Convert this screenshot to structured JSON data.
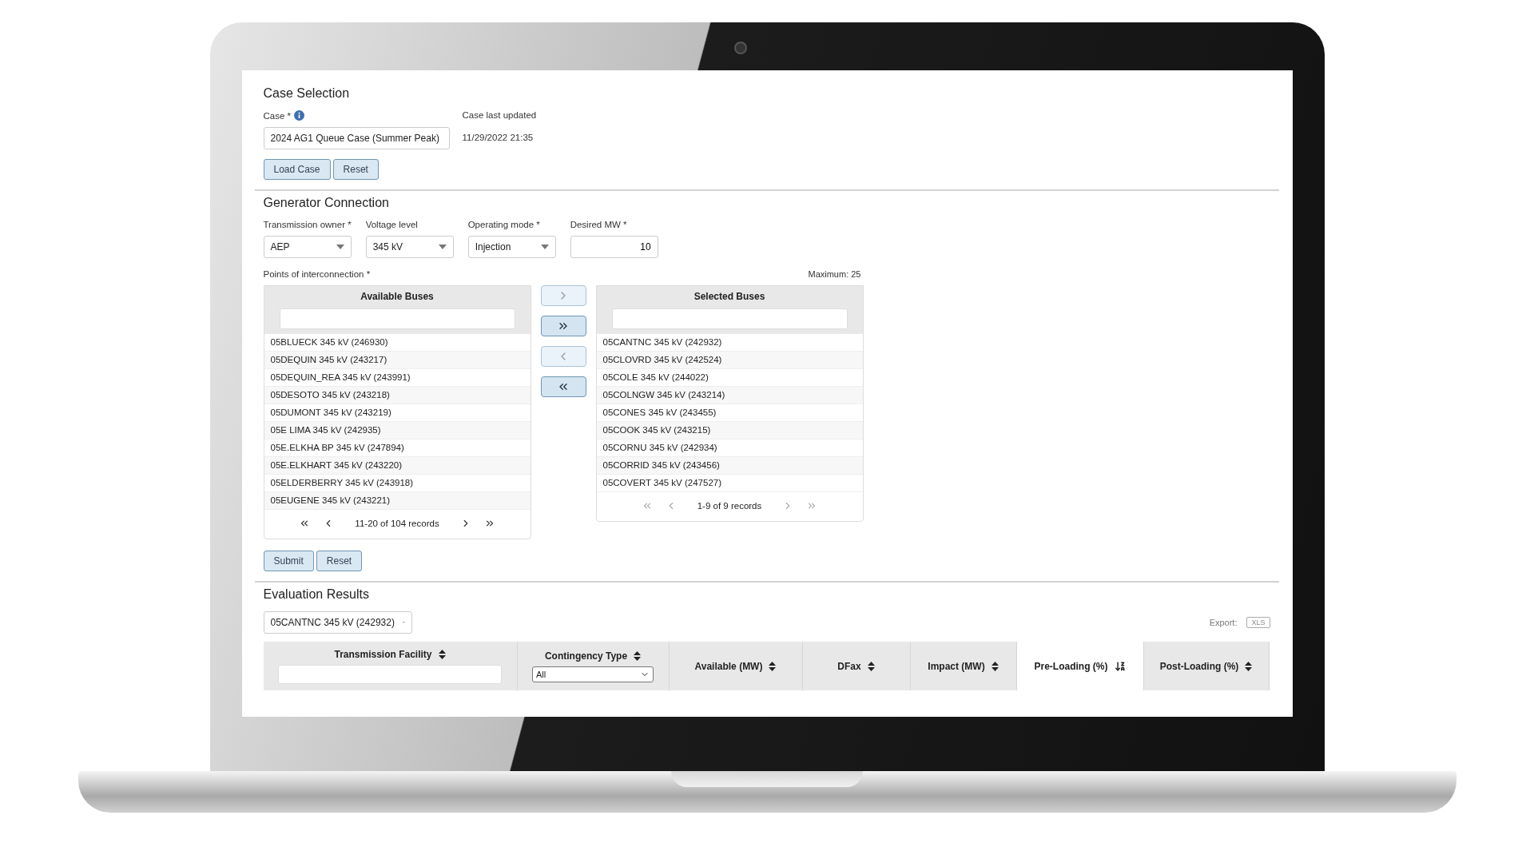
{
  "case_selection": {
    "title": "Case Selection",
    "case_label": "Case *",
    "case_value": "2024 AG1 Queue Case (Summer Peak)",
    "updated_label": "Case last updated",
    "updated_value": "11/29/2022 21:35",
    "buttons": [
      "Load Case",
      "Reset"
    ]
  },
  "generator_connection": {
    "title": "Generator Connection",
    "fields": [
      {
        "kind": "select",
        "label": "Transmission owner *",
        "value": "AEP"
      },
      {
        "kind": "select",
        "label": "Voltage level",
        "value": "345 kV"
      },
      {
        "kind": "select",
        "label": "Operating mode *",
        "value": "Injection"
      },
      {
        "kind": "number",
        "label": "Desired MW *",
        "value": "10"
      }
    ],
    "poi_label": "Points of interconnection *",
    "maximum": "Maximum: 25",
    "available": {
      "title": "Available Buses",
      "items": [
        "05BLUECK 345 kV (246930)",
        "05DEQUIN 345 kV (243217)",
        "05DEQUIN_REA 345 kV (243991)",
        "05DESOTO 345 kV (243218)",
        "05DUMONT 345 kV (243219)",
        "05E LIMA 345 kV (242935)",
        "05E.ELKHA BP 345 kV (247894)",
        "05E.ELKHART 345 kV (243220)",
        "05ELDERBERRY 345 kV (243918)",
        "05EUGENE 345 kV (243221)"
      ],
      "pager": {
        "text": "11-20 of 104 records",
        "back_disabled": false,
        "forward_disabled": false
      }
    },
    "move_buttons": [
      {
        "kind": "right",
        "disabled": true
      },
      {
        "kind": "all-right",
        "disabled": false
      },
      {
        "kind": "left",
        "disabled": true
      },
      {
        "kind": "all-left",
        "disabled": false
      }
    ],
    "selected": {
      "title": "Selected Buses",
      "items": [
        "05CANTNC 345 kV (242932)",
        "05CLOVRD 345 kV (242524)",
        "05COLE 345 kV (244022)",
        "05COLNGW 345 kV (243214)",
        "05CONES 345 kV (243455)",
        "05COOK 345 kV (243215)",
        "05CORNU 345 kV (242934)",
        "05CORRID 345 kV (243456)",
        "05COVERT 345 kV (247527)"
      ],
      "pager": {
        "text": "1-9 of 9 records",
        "back_disabled": true,
        "forward_disabled": true
      }
    },
    "buttons": [
      "Submit",
      "Reset"
    ]
  },
  "evaluation_results": {
    "title": "Evaluation Results",
    "bus_value": "05CANTNC 345 kV (242932)",
    "export_label": "Export:",
    "export_button": "XLS",
    "columns": [
      {
        "kind": "text-filter",
        "label": "Transmission Facility",
        "sorted": false
      },
      {
        "kind": "select-filter",
        "label": "Contingency Type",
        "sorted": false,
        "filter_value": "All"
      },
      {
        "kind": "plain",
        "label": "Available (MW)",
        "sorted": false
      },
      {
        "kind": "plain",
        "label": "DFax",
        "sorted": false
      },
      {
        "kind": "plain",
        "label": "Impact (MW)",
        "sorted": false
      },
      {
        "kind": "plain",
        "label": "Pre-Loading (%)",
        "sorted": true
      },
      {
        "kind": "plain",
        "label": "Post-Loading (%)",
        "sorted": false
      }
    ]
  }
}
